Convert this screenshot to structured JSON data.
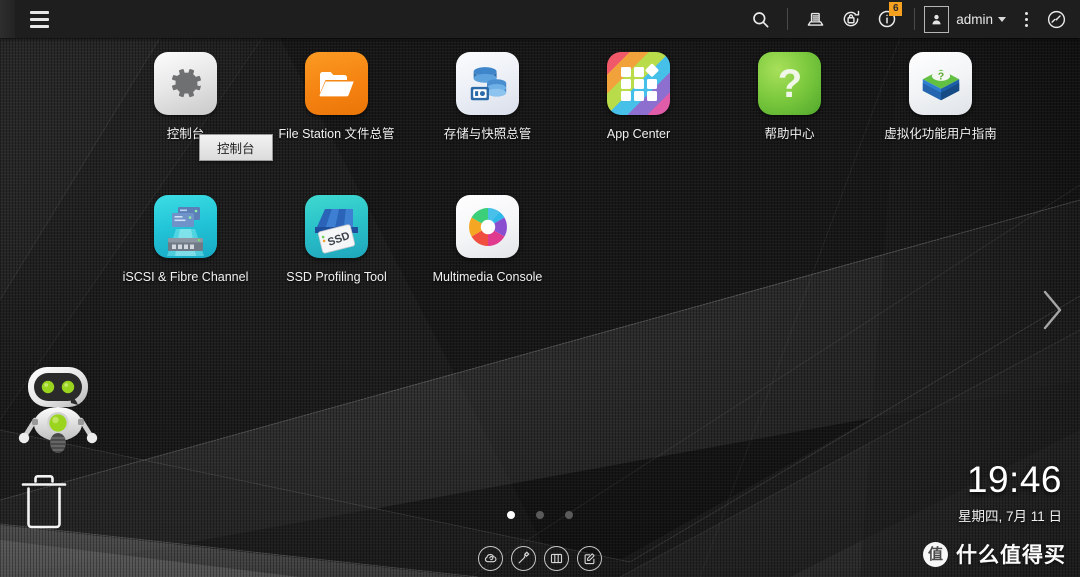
{
  "topbar": {
    "menu_icon": "hamburger-menu-icon",
    "search_icon": "search-icon",
    "backup_icon": "backup-station-icon",
    "security_icon": "security-counselor-icon",
    "info_icon": "info-notification-icon",
    "info_badge": "6",
    "user_icon": "user-avatar-icon",
    "user_name": "admin",
    "more_icon": "kebab-more-icon",
    "dashboard_icon": "dashboard-gauge-icon"
  },
  "desktop": {
    "tooltip": "控制台",
    "apps_row1": [
      {
        "label": "控制台",
        "icon": "control-panel-icon"
      },
      {
        "label": "File Station 文件总管",
        "icon": "file-station-icon"
      },
      {
        "label": "存储与快照总管",
        "icon": "storage-snapshot-manager-icon"
      },
      {
        "label": "App Center",
        "icon": "app-center-icon"
      },
      {
        "label": "帮助中心",
        "icon": "help-center-icon"
      },
      {
        "label": "虚拟化功能用户指南",
        "icon": "virtualization-guide-icon"
      }
    ],
    "apps_row2": [
      {
        "label": "iSCSI & Fibre Channel",
        "icon": "iscsi-fibre-channel-icon"
      },
      {
        "label": "SSD Profiling Tool",
        "icon": "ssd-profiling-tool-icon"
      },
      {
        "label": "Multimedia Console",
        "icon": "multimedia-console-icon"
      }
    ],
    "robot_icon": "qnap-robot-mascot-icon",
    "trash_icon": "trash-can-icon",
    "next_page_icon": "chevron-right-icon",
    "page_dots": [
      {
        "active": true
      },
      {
        "active": false
      },
      {
        "active": false
      }
    ]
  },
  "clock": {
    "time": "19:46",
    "date": "星期四, 7月 11 日"
  },
  "taskbar": [
    {
      "icon": "cloud-link-icon"
    },
    {
      "icon": "hammer-tools-icon"
    },
    {
      "icon": "resource-monitor-icon"
    },
    {
      "icon": "notes-edit-icon"
    }
  ],
  "watermark": {
    "logo": "值",
    "text": "什么值得买"
  },
  "colors": {
    "accent_orange": "#f5a01e",
    "topbar_bg": "#1e1e1e",
    "desktop_bg": "#1a1a1a",
    "text_light": "#f2f2f2"
  }
}
